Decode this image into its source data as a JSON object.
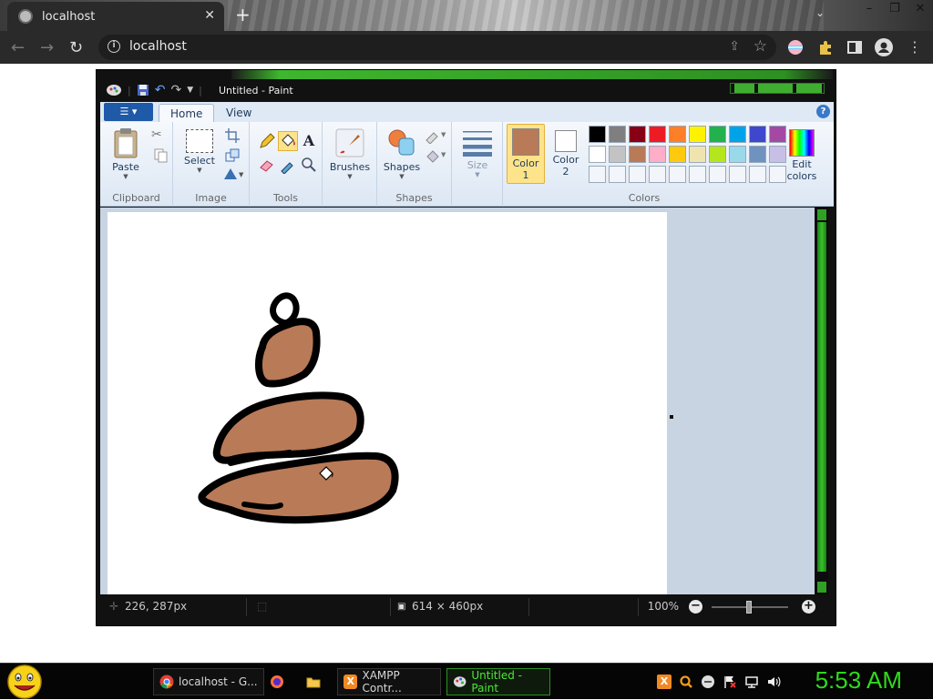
{
  "browser": {
    "tab_title": "localhost",
    "url": "localhost",
    "window_controls": {
      "minimize": "–",
      "maximize": "❐",
      "close": "✕"
    }
  },
  "paint": {
    "title": "Untitled - Paint",
    "ribbon_tabs": [
      "Home",
      "View"
    ],
    "groups": {
      "clipboard": {
        "label": "Clipboard",
        "paste": "Paste"
      },
      "image": {
        "label": "Image",
        "select": "Select"
      },
      "tools": {
        "label": "Tools"
      },
      "brushes": {
        "label": "Brushes"
      },
      "shapes": {
        "label": "Shapes",
        "shapes_btn": "Shapes"
      },
      "size": {
        "label": "Size"
      },
      "colors": {
        "label": "Colors",
        "color1_line1": "Color",
        "color1_line2": "1",
        "color2_line1": "Color",
        "color2_line2": "2",
        "edit_line1": "Edit",
        "edit_line2": "colors",
        "color1_value": "#b97a57",
        "color2_value": "#ffffff",
        "palette_row1": [
          "#000000",
          "#7f7f7f",
          "#880015",
          "#ed1c24",
          "#ff7f27",
          "#fff200",
          "#22b14c",
          "#00a2e8",
          "#3f48cc",
          "#a349a4"
        ],
        "palette_row2": [
          "#ffffff",
          "#c3c3c3",
          "#b97a57",
          "#ffaec9",
          "#ffc90e",
          "#efe4b0",
          "#b5e61d",
          "#99d9ea",
          "#7092be",
          "#c8bfe7"
        ]
      }
    },
    "status": {
      "cursor_pos": "226, 287px",
      "canvas_size": "614 × 460px",
      "zoom": "100%"
    }
  },
  "taskbar": {
    "items": [
      {
        "label": "localhost - G..."
      },
      {
        "label": "XAMPP Contr..."
      },
      {
        "label": "Untitled - Paint"
      }
    ],
    "clock": "5:53 AM"
  }
}
